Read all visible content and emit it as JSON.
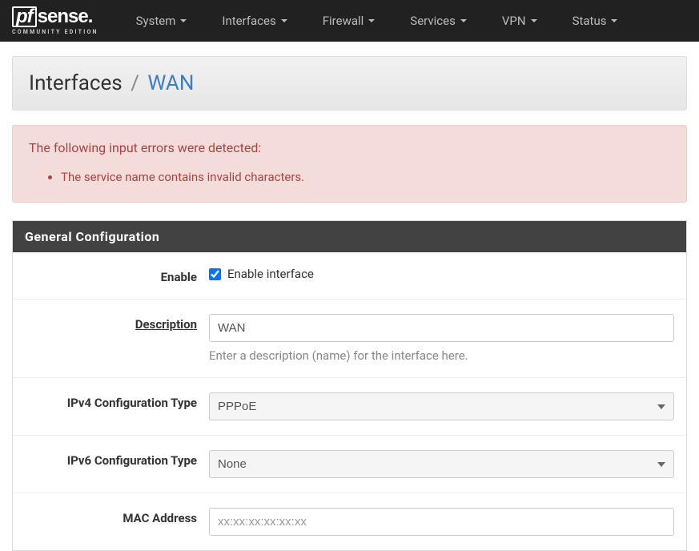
{
  "nav": {
    "logo_main_pf": "pf",
    "logo_main_sense": "sense",
    "logo_sub": "COMMUNITY EDITION",
    "items": [
      {
        "label": "System"
      },
      {
        "label": "Interfaces"
      },
      {
        "label": "Firewall"
      },
      {
        "label": "Services"
      },
      {
        "label": "VPN"
      },
      {
        "label": "Status"
      }
    ]
  },
  "page": {
    "title_main": "Interfaces",
    "title_sep": "/",
    "title_sub": "WAN"
  },
  "alert": {
    "heading": "The following input errors were detected:",
    "errors": [
      "The service name contains invalid characters."
    ]
  },
  "panel": {
    "title": "General Configuration",
    "fields": {
      "enable": {
        "label": "Enable",
        "checkbox_label": "Enable interface",
        "checked": true
      },
      "description": {
        "label": "Description",
        "value": "WAN",
        "help": "Enter a description (name) for the interface here."
      },
      "ipv4_type": {
        "label": "IPv4 Configuration Type",
        "value": "PPPoE"
      },
      "ipv6_type": {
        "label": "IPv6 Configuration Type",
        "value": "None"
      },
      "mac_address": {
        "label": "MAC Address",
        "placeholder": "xx:xx:xx:xx:xx:xx",
        "value": ""
      }
    }
  }
}
